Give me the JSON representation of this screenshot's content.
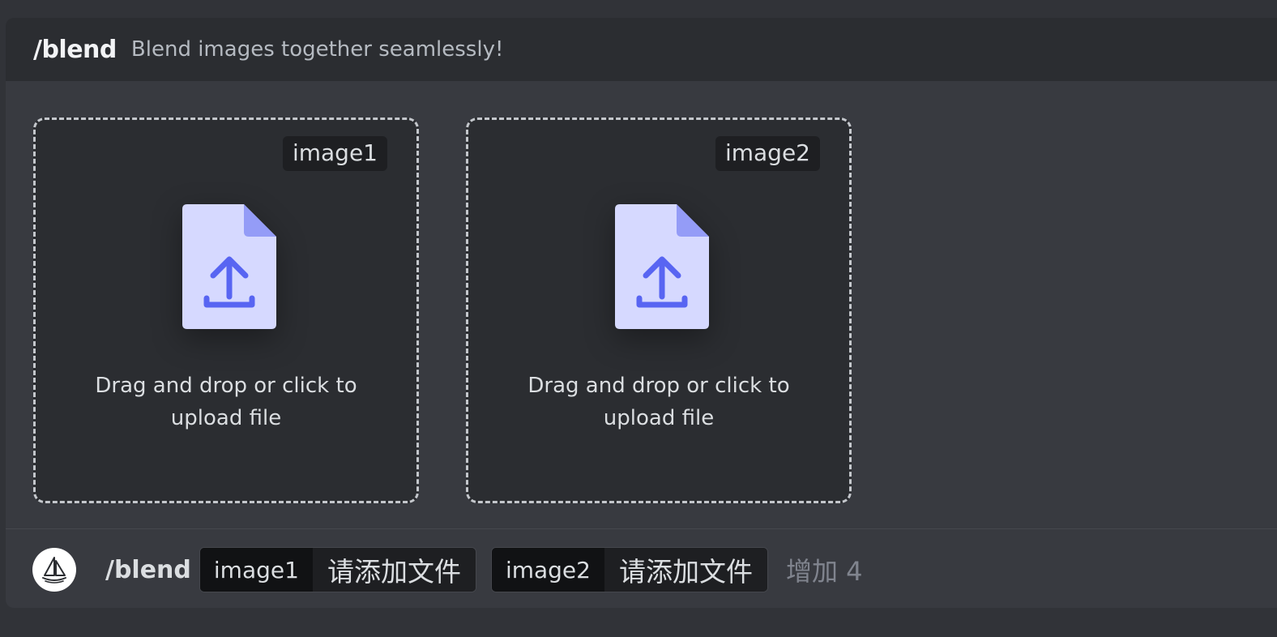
{
  "header": {
    "command": "/blend",
    "description": "Blend images together seamlessly!"
  },
  "dropzones": [
    {
      "tag": "image1",
      "text_line1": "Drag and drop or click to",
      "text_line2": "upload file"
    },
    {
      "tag": "image2",
      "text_line1": "Drag and drop or click to",
      "text_line2": "upload file"
    }
  ],
  "input_row": {
    "avatar_icon": "sailboat-icon",
    "command": "/blend",
    "options": [
      {
        "name": "image1",
        "value": "请添加文件"
      },
      {
        "name": "image2",
        "value": "请添加文件"
      }
    ],
    "more_label": "增加 4"
  },
  "colors": {
    "accent": "#5865f2",
    "file_body": "#d6d9ff",
    "file_fold": "#949cf7"
  }
}
